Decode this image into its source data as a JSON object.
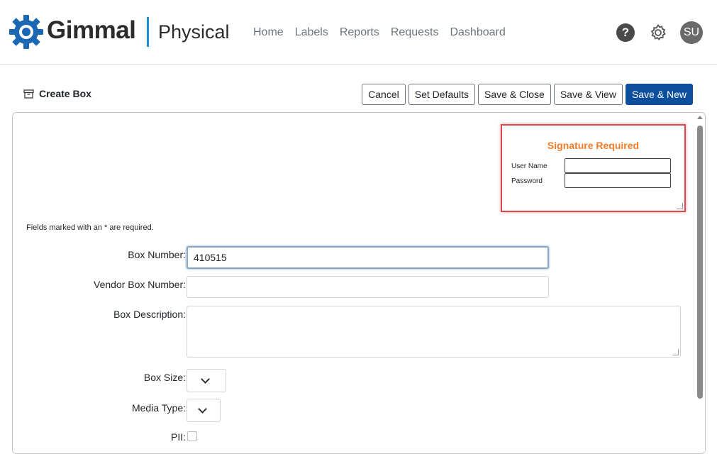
{
  "header": {
    "brand": "Gimmal",
    "product": "Physical",
    "nav": [
      "Home",
      "Labels",
      "Reports",
      "Requests",
      "Dashboard"
    ],
    "help_glyph": "?",
    "avatar_initials": "SU",
    "brand_color": "#1a67b4"
  },
  "page": {
    "title": "Create Box",
    "title_icon": "archive-box-icon"
  },
  "toolbar": {
    "cancel": "Cancel",
    "set_defaults": "Set Defaults",
    "save_close": "Save & Close",
    "save_view": "Save & View",
    "save_new": "Save & New",
    "primary_color": "#0d4f9c"
  },
  "signature": {
    "title": "Signature Required",
    "username_label": "User Name",
    "password_label": "Password",
    "title_color": "#f07b28",
    "border_color": "#e0474c"
  },
  "form": {
    "required_note": "Fields marked with an * are required.",
    "box_number_label": "Box Number:",
    "box_number_value": "410515",
    "vendor_box_number_label": "Vendor Box Number:",
    "vendor_box_number_value": "",
    "box_description_label": "Box Description:",
    "box_description_value": "",
    "box_size_label": "Box Size:",
    "media_type_label": "Media Type:",
    "pii_label": "PII:"
  }
}
